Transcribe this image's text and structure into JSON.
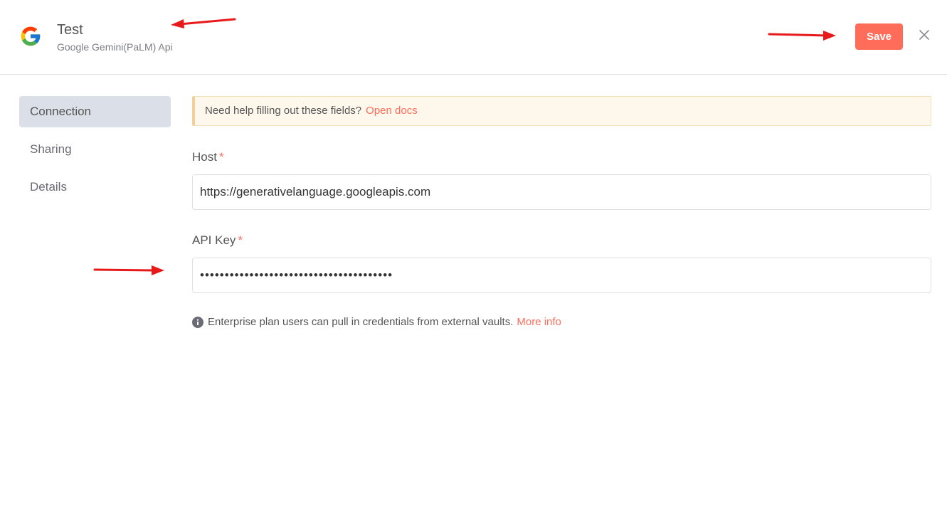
{
  "header": {
    "title": "Test",
    "subtitle": "Google Gemini(PaLM) Api",
    "save_label": "Save",
    "logo_icon": "google-logo",
    "close_icon": "close-icon"
  },
  "sidebar": {
    "items": [
      {
        "label": "Connection",
        "active": true
      },
      {
        "label": "Sharing",
        "active": false
      },
      {
        "label": "Details",
        "active": false
      }
    ]
  },
  "main": {
    "banner": {
      "text": "Need help filling out these fields?",
      "link": "Open docs"
    },
    "host": {
      "label": "Host",
      "required_mark": "*",
      "value": "https://generativelanguage.googleapis.com"
    },
    "api_key": {
      "label": "API Key",
      "required_mark": "*",
      "value": "•••••••••••••••••••••••••••••••••••••••"
    },
    "note": {
      "text": "Enterprise plan users can pull in credentials from external vaults.",
      "link": "More info"
    }
  },
  "colors": {
    "accent": "#ff6d5a",
    "annotation_arrow": "#e8191b"
  }
}
